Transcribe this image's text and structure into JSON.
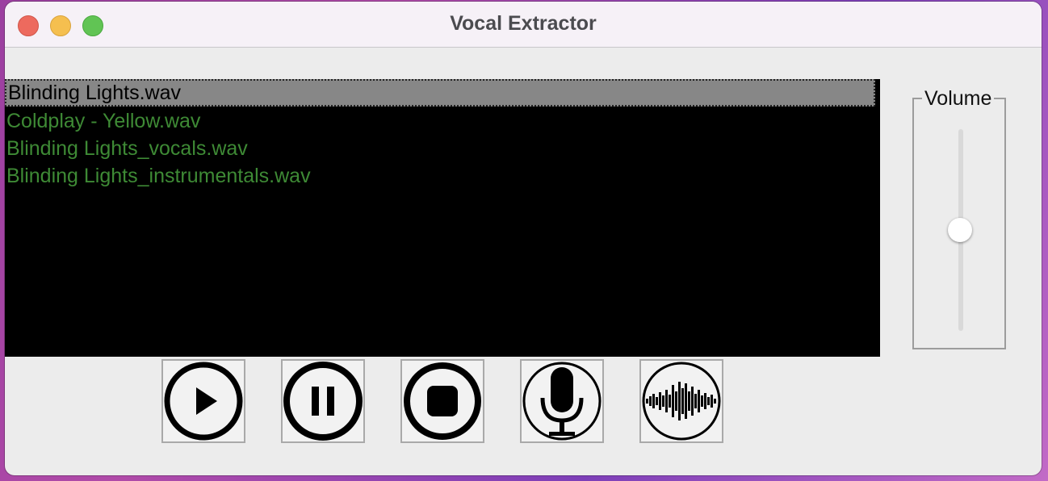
{
  "window": {
    "title": "Vocal Extractor"
  },
  "files": [
    {
      "name": "Blinding Lights.wav",
      "selected": true
    },
    {
      "name": "Coldplay - Yellow.wav",
      "selected": false
    },
    {
      "name": "Blinding Lights_vocals.wav",
      "selected": false
    },
    {
      "name": "Blinding Lights_instrumentals.wav",
      "selected": false
    }
  ],
  "controls": [
    {
      "icon": "play-icon"
    },
    {
      "icon": "pause-icon"
    },
    {
      "icon": "stop-icon"
    },
    {
      "icon": "microphone-icon"
    },
    {
      "icon": "waveform-icon"
    }
  ],
  "volume": {
    "label": "Volume",
    "level": 0.5
  },
  "colors": {
    "list_text": "#3e8a35",
    "selection_bg": "#878787",
    "list_bg": "#000000"
  }
}
